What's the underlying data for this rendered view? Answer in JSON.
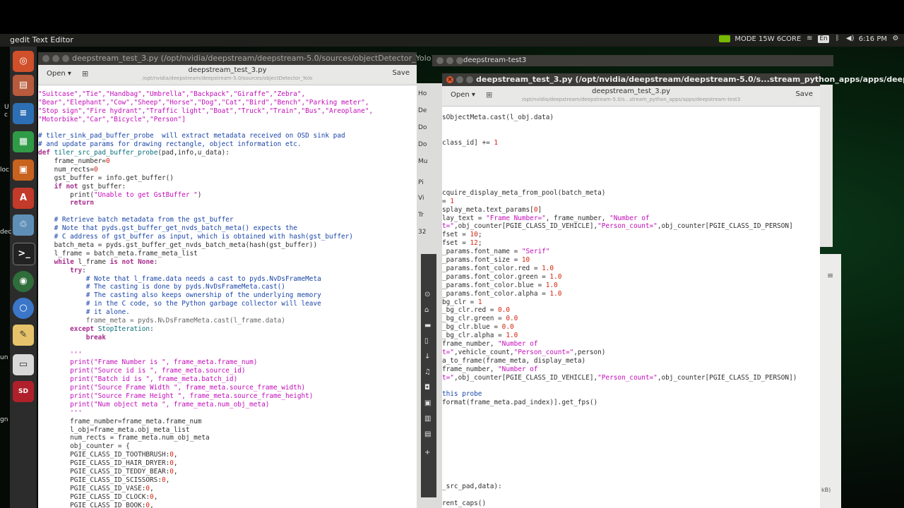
{
  "topbar": {
    "title": "gedit Text Editor",
    "power_mode": "MODE 15W 6CORE",
    "keyboard": "En",
    "time": "6:16 PM"
  },
  "colors": {
    "panel": "#1f1f1c",
    "titlebar": "#3c3b37",
    "keyword": "#a52a8a",
    "string": "#c20cb9",
    "comment": "#1a45a8",
    "number": "#d5240f",
    "close": "#e0562d",
    "nvidia": "#76b900"
  },
  "launcher": {
    "icons": [
      "ubuntu-dash-icon",
      "files-icon",
      "writer-icon",
      "calc-icon",
      "impress-icon",
      "software-icon",
      "trash-files-icon",
      "terminal-icon",
      "web-browser-icon",
      "chromium-icon",
      "text-editor-icon",
      "drive-icon",
      "sd-card-icon"
    ]
  },
  "left_window": {
    "title": "deepstream_test_3.py (/opt/nvidia/deepstream/deepstream-5.0/sources/objectDetector_Yolo) - gedit",
    "open_label": "Open ▾",
    "save_label": "Save",
    "doc_title": "deepstream_test_3.py",
    "doc_path": "/opt/nvidia/deepstream/deepstream-5.0/sources/objectDetector_Yolo"
  },
  "right_window": {
    "frame_title": "deepstream-test3",
    "title": "deepstream_test_3.py (/opt/nvidia/deepstream/deepstream-5.0/s...stream_python_apps/apps/deepstream",
    "open_label": "Open ▾",
    "save_label": "Save",
    "doc_title": "deepstream_test_3.py",
    "doc_path": "/opt/nvidia/deepstream/deepstream-5.0/s...stream_python_apps/apps/deepstream-test3"
  },
  "nautilus_sidebar": [
    "Ho",
    "De",
    "Do",
    "Do",
    "Mu",
    "Pi",
    "Vi",
    "Tr",
    "32"
  ],
  "desktop_labels": [
    "U",
    "c",
    "loc",
    "dec",
    "un",
    "gn"
  ],
  "status_size": "kB)"
}
